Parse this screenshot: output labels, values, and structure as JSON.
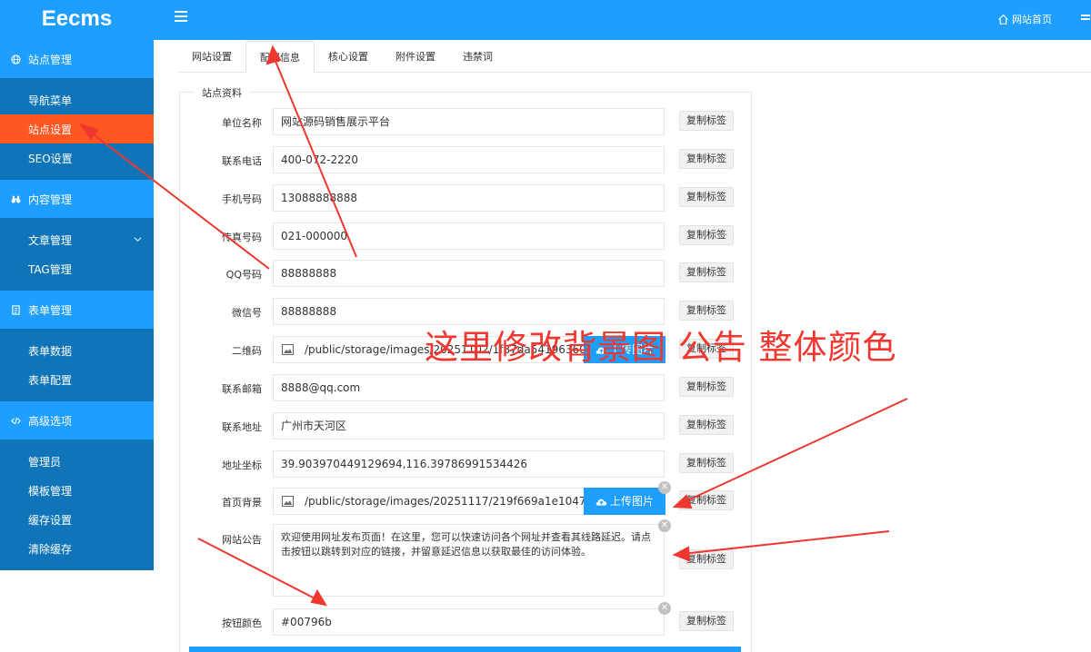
{
  "header": {
    "logo": "Eecms",
    "home_link": "网站首页"
  },
  "sidebar": {
    "groups": [
      {
        "label": "站点管理",
        "icon": "globe-icon",
        "items": [
          "导航菜单",
          "站点设置",
          "SEO设置"
        ]
      },
      {
        "label": "内容管理",
        "icon": "binoculars-icon",
        "items": [
          "文章管理",
          "TAG管理"
        ]
      },
      {
        "label": "表单管理",
        "icon": "form-icon",
        "items": [
          "表单数据",
          "表单配置"
        ]
      },
      {
        "label": "高级选项",
        "icon": "code-icon",
        "items": [
          "管理员",
          "模板管理",
          "缓存设置",
          "清除缓存"
        ]
      }
    ],
    "active_item": "站点设置"
  },
  "tabs": [
    "网站设置",
    "配置信息",
    "核心设置",
    "附件设置",
    "违禁词"
  ],
  "active_tab": "配置信息",
  "form": {
    "legend": "站点资料",
    "copy_label": "复制标签",
    "upload_label": "上传图片",
    "fields": {
      "company": {
        "label": "单位名称",
        "value": "网站源码销售展示平台"
      },
      "phone": {
        "label": "联系电话",
        "value": "400-072-2220"
      },
      "mobile": {
        "label": "手机号码",
        "value": "13088888888"
      },
      "fax": {
        "label": "传真号码",
        "value": "021-000000"
      },
      "qq": {
        "label": "QQ号码",
        "value": "88888888"
      },
      "wechat": {
        "label": "微信号",
        "value": "88888888"
      },
      "qrcode": {
        "label": "二维码",
        "value": "/public/storage/images/20251102/1f87da541963602241"
      },
      "email": {
        "label": "联系邮箱",
        "value": "8888@qq.com"
      },
      "address": {
        "label": "联系地址",
        "value": "广州市天河区"
      },
      "coords": {
        "label": "地址坐标",
        "value": "39.903970449129694,116.39786991534426"
      },
      "home_bg": {
        "label": "首页背景",
        "value": "/public/storage/images/20251117/219f669a1e104721b049"
      },
      "notice": {
        "label": "网站公告",
        "value": "欢迎使用网址发布页面！在这里，您可以快速访问各个网址并查看其线路延迟。请点击按钮以跳转到对应的链接，并留意延迟信息以获取最佳的访问体验。"
      },
      "button_color": {
        "label": "按钮颜色",
        "value": "#00796b"
      }
    }
  },
  "annotation": "这里修改背景图 公告  整体颜色",
  "colors": {
    "primary": "#1E9FFF",
    "sidebar_dark": "#1075b8",
    "active": "#FF5722",
    "annotation": "#f0372f"
  }
}
